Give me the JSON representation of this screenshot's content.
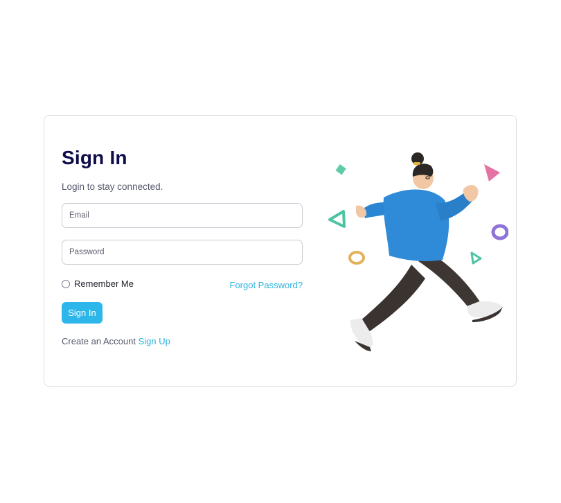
{
  "login": {
    "title": "Sign In",
    "subtitle": "Login to stay connected.",
    "email_placeholder": "Email",
    "password_placeholder": "Password",
    "remember_label": "Remember Me",
    "forgot_link": "Forgot Password?",
    "submit_label": "Sign In",
    "create_text": "Create an Account",
    "signup_link": "Sign Up"
  },
  "colors": {
    "title": "#0f0c4a",
    "accent": "#2cb6ea",
    "link": "#2db2e1",
    "border": "#dcdde3"
  },
  "illustration": {
    "icon": "running-person-illustration"
  }
}
